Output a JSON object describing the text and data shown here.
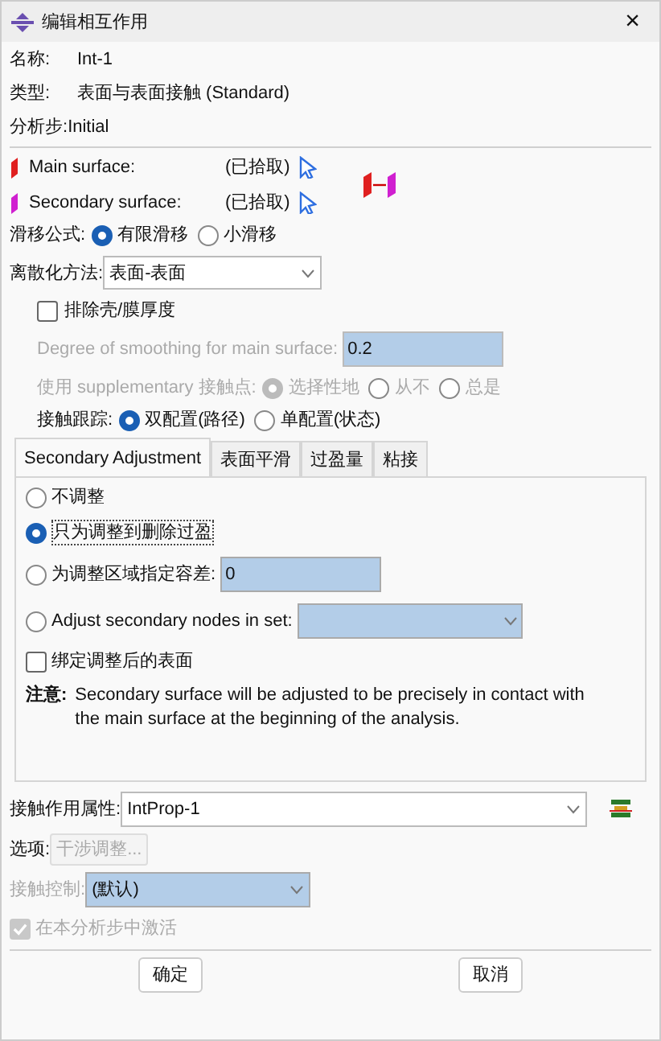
{
  "window": {
    "title": "编辑相互作用",
    "close": "×"
  },
  "info": [
    {
      "label": "名称:",
      "value": "Int-1"
    },
    {
      "label": "类型:",
      "value": "表面与表面接触 (Standard)"
    },
    {
      "label": "分析步:",
      "value": "Initial"
    }
  ],
  "surfaces": [
    {
      "label": "Main surface:",
      "status": "(已拾取)",
      "color": "#e02020"
    },
    {
      "label": "Secondary surface:",
      "status": "(已拾取)",
      "color": "#d020d0"
    }
  ],
  "sliding": {
    "label": "滑移公式:",
    "options": [
      {
        "label": "有限滑移",
        "selected": true
      },
      {
        "label": "小滑移",
        "selected": false
      }
    ]
  },
  "discretization": {
    "label": "离散化方法:",
    "value": "表面-表面"
  },
  "exclude_shell": {
    "label": "排除壳/膜厚度",
    "checked": false
  },
  "smoothing": {
    "label": "Degree of smoothing for main surface:",
    "value": "0.2",
    "disabled": true
  },
  "supplementary": {
    "label": "使用 supplementary 接触点:",
    "disabled": true,
    "options": [
      {
        "label": "选择性地",
        "selected": true
      },
      {
        "label": "从不",
        "selected": false
      },
      {
        "label": "总是",
        "selected": false
      }
    ]
  },
  "tracking": {
    "label": "接触跟踪:",
    "options": [
      {
        "label": "双配置(路径)",
        "selected": true
      },
      {
        "label": "单配置(状态)",
        "selected": false
      }
    ]
  },
  "tabs": [
    {
      "label": "Secondary Adjustment",
      "selected": true
    },
    {
      "label": "表面平滑",
      "selected": false
    },
    {
      "label": "过盈量",
      "selected": false
    },
    {
      "label": "粘接",
      "selected": false
    }
  ],
  "adjust_options": [
    {
      "kind": "plain",
      "label": "不调整",
      "selected": false
    },
    {
      "kind": "plain",
      "label": "只为调整到删除过盈",
      "selected": true
    },
    {
      "kind": "input",
      "label": "为调整区域指定容差:",
      "value": "0",
      "selected": false
    },
    {
      "kind": "select",
      "label": "Adjust secondary nodes in set:",
      "selected": false
    }
  ],
  "tie_adjusted": {
    "label": "绑定调整后的表面",
    "checked": false
  },
  "note": {
    "label": "注意:",
    "text": "Secondary surface will be adjusted to be precisely in contact with the main surface at the beginning of the analysis."
  },
  "property": {
    "label": "接触作用属性:",
    "value": "IntProp-1"
  },
  "options": {
    "label": "选项:",
    "button": "干涉调整...",
    "disabled": true
  },
  "control": {
    "label": "接触控制:",
    "value": "(默认)",
    "disabled": true
  },
  "active": {
    "label": "在本分析步中激活",
    "checked": true,
    "disabled": true
  },
  "buttons": [
    "确定",
    "取消"
  ]
}
